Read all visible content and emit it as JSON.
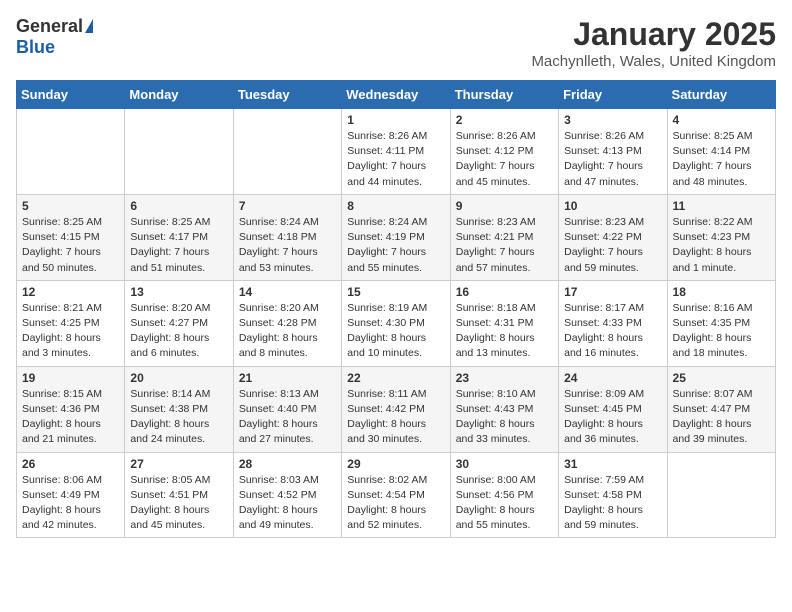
{
  "header": {
    "logo_general": "General",
    "logo_blue": "Blue",
    "month_title": "January 2025",
    "location": "Machynlleth, Wales, United Kingdom"
  },
  "days_of_week": [
    "Sunday",
    "Monday",
    "Tuesday",
    "Wednesday",
    "Thursday",
    "Friday",
    "Saturday"
  ],
  "weeks": [
    [
      {
        "day": "",
        "sunrise": "",
        "sunset": "",
        "daylight": ""
      },
      {
        "day": "",
        "sunrise": "",
        "sunset": "",
        "daylight": ""
      },
      {
        "day": "",
        "sunrise": "",
        "sunset": "",
        "daylight": ""
      },
      {
        "day": "1",
        "sunrise": "Sunrise: 8:26 AM",
        "sunset": "Sunset: 4:11 PM",
        "daylight": "Daylight: 7 hours and 44 minutes."
      },
      {
        "day": "2",
        "sunrise": "Sunrise: 8:26 AM",
        "sunset": "Sunset: 4:12 PM",
        "daylight": "Daylight: 7 hours and 45 minutes."
      },
      {
        "day": "3",
        "sunrise": "Sunrise: 8:26 AM",
        "sunset": "Sunset: 4:13 PM",
        "daylight": "Daylight: 7 hours and 47 minutes."
      },
      {
        "day": "4",
        "sunrise": "Sunrise: 8:25 AM",
        "sunset": "Sunset: 4:14 PM",
        "daylight": "Daylight: 7 hours and 48 minutes."
      }
    ],
    [
      {
        "day": "5",
        "sunrise": "Sunrise: 8:25 AM",
        "sunset": "Sunset: 4:15 PM",
        "daylight": "Daylight: 7 hours and 50 minutes."
      },
      {
        "day": "6",
        "sunrise": "Sunrise: 8:25 AM",
        "sunset": "Sunset: 4:17 PM",
        "daylight": "Daylight: 7 hours and 51 minutes."
      },
      {
        "day": "7",
        "sunrise": "Sunrise: 8:24 AM",
        "sunset": "Sunset: 4:18 PM",
        "daylight": "Daylight: 7 hours and 53 minutes."
      },
      {
        "day": "8",
        "sunrise": "Sunrise: 8:24 AM",
        "sunset": "Sunset: 4:19 PM",
        "daylight": "Daylight: 7 hours and 55 minutes."
      },
      {
        "day": "9",
        "sunrise": "Sunrise: 8:23 AM",
        "sunset": "Sunset: 4:21 PM",
        "daylight": "Daylight: 7 hours and 57 minutes."
      },
      {
        "day": "10",
        "sunrise": "Sunrise: 8:23 AM",
        "sunset": "Sunset: 4:22 PM",
        "daylight": "Daylight: 7 hours and 59 minutes."
      },
      {
        "day": "11",
        "sunrise": "Sunrise: 8:22 AM",
        "sunset": "Sunset: 4:23 PM",
        "daylight": "Daylight: 8 hours and 1 minute."
      }
    ],
    [
      {
        "day": "12",
        "sunrise": "Sunrise: 8:21 AM",
        "sunset": "Sunset: 4:25 PM",
        "daylight": "Daylight: 8 hours and 3 minutes."
      },
      {
        "day": "13",
        "sunrise": "Sunrise: 8:20 AM",
        "sunset": "Sunset: 4:27 PM",
        "daylight": "Daylight: 8 hours and 6 minutes."
      },
      {
        "day": "14",
        "sunrise": "Sunrise: 8:20 AM",
        "sunset": "Sunset: 4:28 PM",
        "daylight": "Daylight: 8 hours and 8 minutes."
      },
      {
        "day": "15",
        "sunrise": "Sunrise: 8:19 AM",
        "sunset": "Sunset: 4:30 PM",
        "daylight": "Daylight: 8 hours and 10 minutes."
      },
      {
        "day": "16",
        "sunrise": "Sunrise: 8:18 AM",
        "sunset": "Sunset: 4:31 PM",
        "daylight": "Daylight: 8 hours and 13 minutes."
      },
      {
        "day": "17",
        "sunrise": "Sunrise: 8:17 AM",
        "sunset": "Sunset: 4:33 PM",
        "daylight": "Daylight: 8 hours and 16 minutes."
      },
      {
        "day": "18",
        "sunrise": "Sunrise: 8:16 AM",
        "sunset": "Sunset: 4:35 PM",
        "daylight": "Daylight: 8 hours and 18 minutes."
      }
    ],
    [
      {
        "day": "19",
        "sunrise": "Sunrise: 8:15 AM",
        "sunset": "Sunset: 4:36 PM",
        "daylight": "Daylight: 8 hours and 21 minutes."
      },
      {
        "day": "20",
        "sunrise": "Sunrise: 8:14 AM",
        "sunset": "Sunset: 4:38 PM",
        "daylight": "Daylight: 8 hours and 24 minutes."
      },
      {
        "day": "21",
        "sunrise": "Sunrise: 8:13 AM",
        "sunset": "Sunset: 4:40 PM",
        "daylight": "Daylight: 8 hours and 27 minutes."
      },
      {
        "day": "22",
        "sunrise": "Sunrise: 8:11 AM",
        "sunset": "Sunset: 4:42 PM",
        "daylight": "Daylight: 8 hours and 30 minutes."
      },
      {
        "day": "23",
        "sunrise": "Sunrise: 8:10 AM",
        "sunset": "Sunset: 4:43 PM",
        "daylight": "Daylight: 8 hours and 33 minutes."
      },
      {
        "day": "24",
        "sunrise": "Sunrise: 8:09 AM",
        "sunset": "Sunset: 4:45 PM",
        "daylight": "Daylight: 8 hours and 36 minutes."
      },
      {
        "day": "25",
        "sunrise": "Sunrise: 8:07 AM",
        "sunset": "Sunset: 4:47 PM",
        "daylight": "Daylight: 8 hours and 39 minutes."
      }
    ],
    [
      {
        "day": "26",
        "sunrise": "Sunrise: 8:06 AM",
        "sunset": "Sunset: 4:49 PM",
        "daylight": "Daylight: 8 hours and 42 minutes."
      },
      {
        "day": "27",
        "sunrise": "Sunrise: 8:05 AM",
        "sunset": "Sunset: 4:51 PM",
        "daylight": "Daylight: 8 hours and 45 minutes."
      },
      {
        "day": "28",
        "sunrise": "Sunrise: 8:03 AM",
        "sunset": "Sunset: 4:52 PM",
        "daylight": "Daylight: 8 hours and 49 minutes."
      },
      {
        "day": "29",
        "sunrise": "Sunrise: 8:02 AM",
        "sunset": "Sunset: 4:54 PM",
        "daylight": "Daylight: 8 hours and 52 minutes."
      },
      {
        "day": "30",
        "sunrise": "Sunrise: 8:00 AM",
        "sunset": "Sunset: 4:56 PM",
        "daylight": "Daylight: 8 hours and 55 minutes."
      },
      {
        "day": "31",
        "sunrise": "Sunrise: 7:59 AM",
        "sunset": "Sunset: 4:58 PM",
        "daylight": "Daylight: 8 hours and 59 minutes."
      },
      {
        "day": "",
        "sunrise": "",
        "sunset": "",
        "daylight": ""
      }
    ]
  ]
}
